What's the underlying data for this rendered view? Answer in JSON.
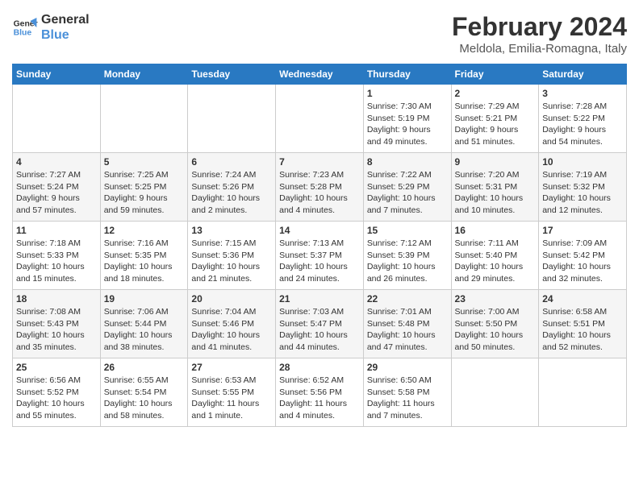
{
  "header": {
    "logo_line1": "General",
    "logo_line2": "Blue",
    "title": "February 2024",
    "subtitle": "Meldola, Emilia-Romagna, Italy"
  },
  "weekdays": [
    "Sunday",
    "Monday",
    "Tuesday",
    "Wednesday",
    "Thursday",
    "Friday",
    "Saturday"
  ],
  "weeks": [
    [
      {
        "day": "",
        "info": ""
      },
      {
        "day": "",
        "info": ""
      },
      {
        "day": "",
        "info": ""
      },
      {
        "day": "",
        "info": ""
      },
      {
        "day": "1",
        "info": "Sunrise: 7:30 AM\nSunset: 5:19 PM\nDaylight: 9 hours\nand 49 minutes."
      },
      {
        "day": "2",
        "info": "Sunrise: 7:29 AM\nSunset: 5:21 PM\nDaylight: 9 hours\nand 51 minutes."
      },
      {
        "day": "3",
        "info": "Sunrise: 7:28 AM\nSunset: 5:22 PM\nDaylight: 9 hours\nand 54 minutes."
      }
    ],
    [
      {
        "day": "4",
        "info": "Sunrise: 7:27 AM\nSunset: 5:24 PM\nDaylight: 9 hours\nand 57 minutes."
      },
      {
        "day": "5",
        "info": "Sunrise: 7:25 AM\nSunset: 5:25 PM\nDaylight: 9 hours\nand 59 minutes."
      },
      {
        "day": "6",
        "info": "Sunrise: 7:24 AM\nSunset: 5:26 PM\nDaylight: 10 hours\nand 2 minutes."
      },
      {
        "day": "7",
        "info": "Sunrise: 7:23 AM\nSunset: 5:28 PM\nDaylight: 10 hours\nand 4 minutes."
      },
      {
        "day": "8",
        "info": "Sunrise: 7:22 AM\nSunset: 5:29 PM\nDaylight: 10 hours\nand 7 minutes."
      },
      {
        "day": "9",
        "info": "Sunrise: 7:20 AM\nSunset: 5:31 PM\nDaylight: 10 hours\nand 10 minutes."
      },
      {
        "day": "10",
        "info": "Sunrise: 7:19 AM\nSunset: 5:32 PM\nDaylight: 10 hours\nand 12 minutes."
      }
    ],
    [
      {
        "day": "11",
        "info": "Sunrise: 7:18 AM\nSunset: 5:33 PM\nDaylight: 10 hours\nand 15 minutes."
      },
      {
        "day": "12",
        "info": "Sunrise: 7:16 AM\nSunset: 5:35 PM\nDaylight: 10 hours\nand 18 minutes."
      },
      {
        "day": "13",
        "info": "Sunrise: 7:15 AM\nSunset: 5:36 PM\nDaylight: 10 hours\nand 21 minutes."
      },
      {
        "day": "14",
        "info": "Sunrise: 7:13 AM\nSunset: 5:37 PM\nDaylight: 10 hours\nand 24 minutes."
      },
      {
        "day": "15",
        "info": "Sunrise: 7:12 AM\nSunset: 5:39 PM\nDaylight: 10 hours\nand 26 minutes."
      },
      {
        "day": "16",
        "info": "Sunrise: 7:11 AM\nSunset: 5:40 PM\nDaylight: 10 hours\nand 29 minutes."
      },
      {
        "day": "17",
        "info": "Sunrise: 7:09 AM\nSunset: 5:42 PM\nDaylight: 10 hours\nand 32 minutes."
      }
    ],
    [
      {
        "day": "18",
        "info": "Sunrise: 7:08 AM\nSunset: 5:43 PM\nDaylight: 10 hours\nand 35 minutes."
      },
      {
        "day": "19",
        "info": "Sunrise: 7:06 AM\nSunset: 5:44 PM\nDaylight: 10 hours\nand 38 minutes."
      },
      {
        "day": "20",
        "info": "Sunrise: 7:04 AM\nSunset: 5:46 PM\nDaylight: 10 hours\nand 41 minutes."
      },
      {
        "day": "21",
        "info": "Sunrise: 7:03 AM\nSunset: 5:47 PM\nDaylight: 10 hours\nand 44 minutes."
      },
      {
        "day": "22",
        "info": "Sunrise: 7:01 AM\nSunset: 5:48 PM\nDaylight: 10 hours\nand 47 minutes."
      },
      {
        "day": "23",
        "info": "Sunrise: 7:00 AM\nSunset: 5:50 PM\nDaylight: 10 hours\nand 50 minutes."
      },
      {
        "day": "24",
        "info": "Sunrise: 6:58 AM\nSunset: 5:51 PM\nDaylight: 10 hours\nand 52 minutes."
      }
    ],
    [
      {
        "day": "25",
        "info": "Sunrise: 6:56 AM\nSunset: 5:52 PM\nDaylight: 10 hours\nand 55 minutes."
      },
      {
        "day": "26",
        "info": "Sunrise: 6:55 AM\nSunset: 5:54 PM\nDaylight: 10 hours\nand 58 minutes."
      },
      {
        "day": "27",
        "info": "Sunrise: 6:53 AM\nSunset: 5:55 PM\nDaylight: 11 hours\nand 1 minute."
      },
      {
        "day": "28",
        "info": "Sunrise: 6:52 AM\nSunset: 5:56 PM\nDaylight: 11 hours\nand 4 minutes."
      },
      {
        "day": "29",
        "info": "Sunrise: 6:50 AM\nSunset: 5:58 PM\nDaylight: 11 hours\nand 7 minutes."
      },
      {
        "day": "",
        "info": ""
      },
      {
        "day": "",
        "info": ""
      }
    ]
  ]
}
